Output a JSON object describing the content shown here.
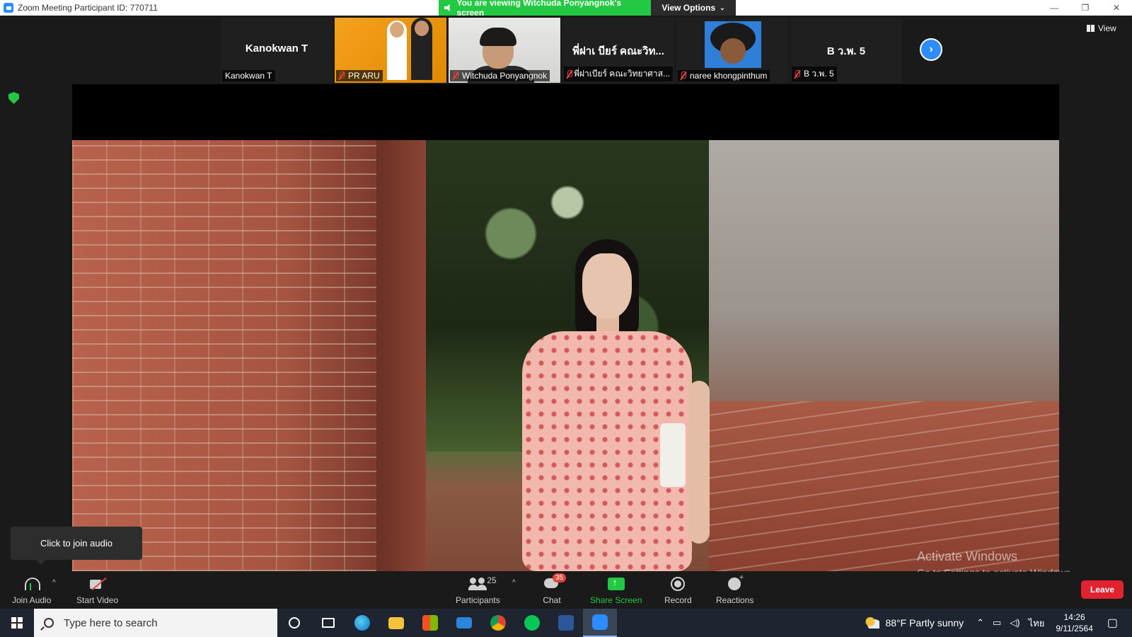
{
  "window": {
    "title": "Zoom Meeting Participant ID: 770711",
    "minimize": "—",
    "restore": "❐",
    "close": "✕"
  },
  "share_banner": {
    "text": "You are viewing Witchuda Ponyangnok's screen",
    "options_label": "View Options",
    "options_chevron": "⌄"
  },
  "gallery": {
    "tiles": [
      {
        "big_name": "Kanokwan T",
        "label": "Kanokwan T",
        "muted": false
      },
      {
        "big_name": "",
        "label": "PR ARU",
        "muted": true
      },
      {
        "big_name": "",
        "label": "Witchuda Ponyangnok",
        "muted": true
      },
      {
        "big_name": "พี่ฝาเ บียร์ คณะวิท...",
        "label": "พี่ฝาเบียร์ คณะวิทยาศาส...",
        "muted": true
      },
      {
        "big_name": "",
        "label": "naree khongpinthum",
        "muted": true
      },
      {
        "big_name": "B ว.พ. 5",
        "label": "B ว.พ. 5",
        "muted": true
      }
    ],
    "next_arrow": "›",
    "view_label": "View"
  },
  "watermark": {
    "line1": "Activate Windows",
    "line2": "Go to Settings to activate Windows."
  },
  "tooltip": {
    "text": "Click to join audio"
  },
  "controls": {
    "join_audio": "Join Audio",
    "start_video": "Start Video",
    "participants": "Participants",
    "participants_count": "25",
    "chat": "Chat",
    "chat_badge": "35",
    "share_screen": "Share Screen",
    "record": "Record",
    "reactions": "Reactions",
    "leave": "Leave",
    "caret": "^"
  },
  "taskbar": {
    "search_placeholder": "Type here to search",
    "weather": "88°F  Partly sunny",
    "language": "ไทย",
    "time": "14:26",
    "date": "9/11/2564"
  },
  "colors": {
    "zoom_blue": "#2d8cff",
    "share_green": "#23c843",
    "leave_red": "#e0232e"
  }
}
